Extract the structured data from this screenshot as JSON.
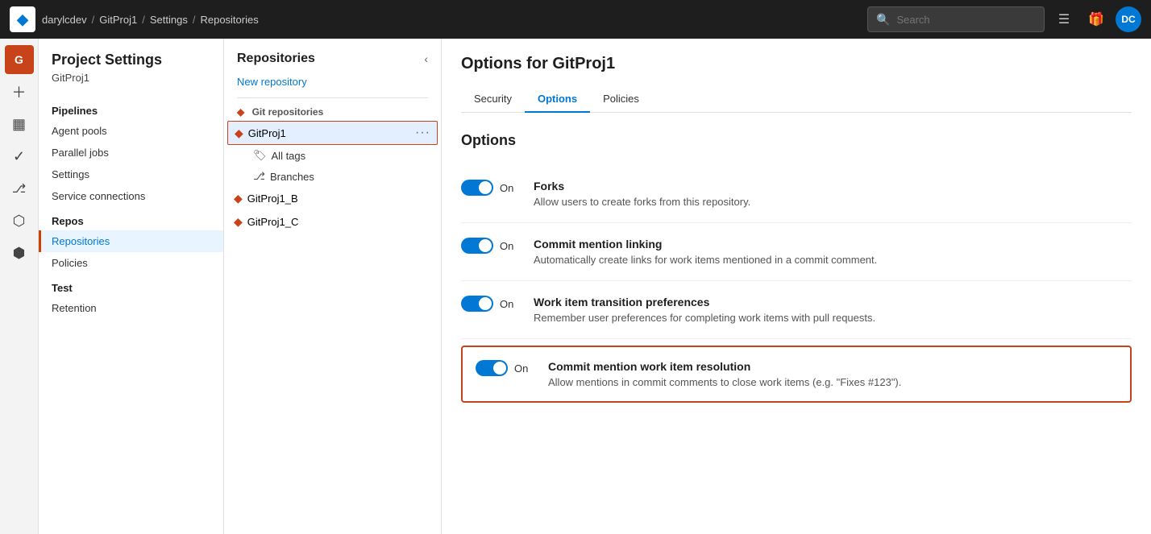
{
  "topbar": {
    "logo": "◆",
    "breadcrumb": [
      {
        "label": "darylcdev",
        "sep": "/"
      },
      {
        "label": "GitProj1",
        "sep": "/"
      },
      {
        "label": "Settings",
        "sep": "/"
      },
      {
        "label": "Repositories",
        "sep": ""
      }
    ],
    "search_placeholder": "Search",
    "avatar_initials": "DC"
  },
  "rail": {
    "icons": [
      {
        "name": "org-icon",
        "glyph": "G",
        "active": true
      },
      {
        "name": "add-icon",
        "glyph": "+"
      },
      {
        "name": "board-icon",
        "glyph": "▦"
      },
      {
        "name": "check-icon",
        "glyph": "✓"
      },
      {
        "name": "pr-icon",
        "glyph": "⎇"
      },
      {
        "name": "pipe-icon",
        "glyph": "⬡"
      },
      {
        "name": "artifact-icon",
        "glyph": "⬢"
      }
    ]
  },
  "sidebar": {
    "title": "Project Settings",
    "subtitle": "GitProj1",
    "sections": [
      {
        "label": "Pipelines",
        "items": [
          {
            "label": "Agent pools",
            "active": false
          },
          {
            "label": "Parallel jobs",
            "active": false
          },
          {
            "label": "Settings",
            "active": false
          },
          {
            "label": "Service connections",
            "active": false
          }
        ]
      },
      {
        "label": "Repos",
        "items": [
          {
            "label": "Repositories",
            "active": true
          },
          {
            "label": "Policies",
            "active": false
          }
        ]
      },
      {
        "label": "Test",
        "items": [
          {
            "label": "Retention",
            "active": false
          }
        ]
      }
    ]
  },
  "mid_panel": {
    "title": "Repositories",
    "new_repo_label": "New repository",
    "section_label": "Git repositories",
    "repos": [
      {
        "name": "GitProj1",
        "active": true,
        "sub_items": [
          {
            "label": "All tags",
            "icon": "🏷"
          },
          {
            "label": "Branches",
            "icon": "⎇"
          }
        ]
      },
      {
        "name": "GitProj1_B",
        "active": false
      },
      {
        "name": "GitProj1_C",
        "active": false
      }
    ]
  },
  "content": {
    "title": "Options for GitProj1",
    "tabs": [
      {
        "label": "Security",
        "active": false
      },
      {
        "label": "Options",
        "active": true
      },
      {
        "label": "Policies",
        "active": false
      }
    ],
    "section_label": "Options",
    "options": [
      {
        "id": "forks",
        "toggle_state": "On",
        "title": "Forks",
        "description": "Allow users to create forks from this repository.",
        "highlighted": false
      },
      {
        "id": "commit-mention-linking",
        "toggle_state": "On",
        "title": "Commit mention linking",
        "description": "Automatically create links for work items mentioned in a commit comment.",
        "highlighted": false
      },
      {
        "id": "work-item-transition",
        "toggle_state": "On",
        "title": "Work item transition preferences",
        "description": "Remember user preferences for completing work items with pull requests.",
        "highlighted": false
      },
      {
        "id": "commit-mention-resolution",
        "toggle_state": "On",
        "title": "Commit mention work item resolution",
        "description": "Allow mentions in commit comments to close work items (e.g. \"Fixes #123\").",
        "highlighted": true
      }
    ]
  }
}
